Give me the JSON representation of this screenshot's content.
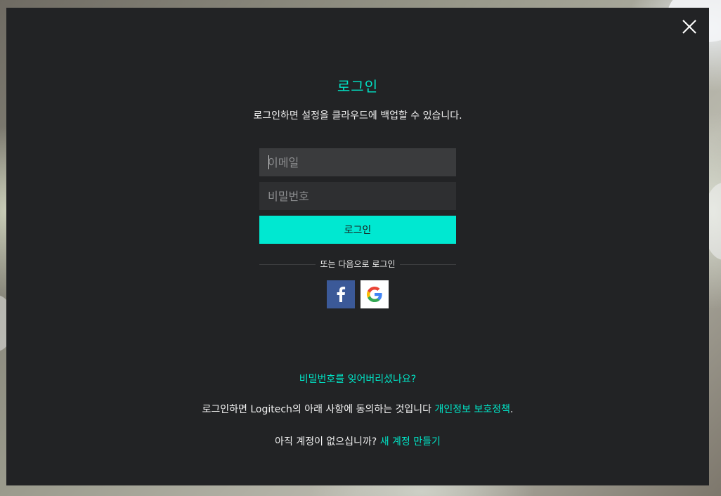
{
  "title": "로그인",
  "subtitle": "로그인하면 설정을 클라우드에 백업할 수 있습니다.",
  "email_placeholder": "이메일",
  "password_placeholder": "비밀번호",
  "login_button": "로그인",
  "divider_text": "또는 다음으로 로그인",
  "social": {
    "facebook_icon": "facebook-icon",
    "google_icon": "google-icon"
  },
  "forgot_password": "비밀번호를 잊어버리셨나요?",
  "terms": {
    "text": "로그인하면 Logitech의 아래 사항에 동의하는 것입니다 ",
    "link": "개인정보 보호정책",
    "suffix": "."
  },
  "signup": {
    "text": "아직 계정이 없으십니까? ",
    "link": "새 계정 만들기"
  },
  "colors": {
    "accent": "#00e5c7",
    "button": "#00e8d1",
    "modal_bg": "#222325",
    "facebook": "#3b5998"
  }
}
